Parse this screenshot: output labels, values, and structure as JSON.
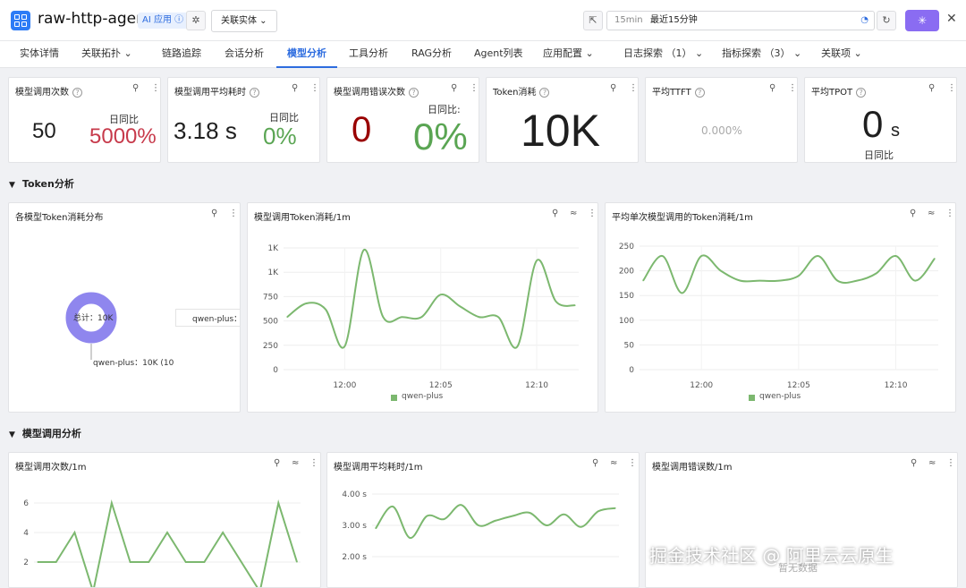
{
  "header": {
    "title": "raw-http-agent",
    "ai_badge": "AI 应用 ⓘ",
    "related_entity": "关联实体 ⌄",
    "time_prefix": "15min",
    "time_value": "最近15分钟"
  },
  "tabs": [
    {
      "label": "实体详情"
    },
    {
      "label": "关联拓扑 ⌄"
    },
    {
      "label": "链路追踪"
    },
    {
      "label": "会话分析"
    },
    {
      "label": "模型分析"
    },
    {
      "label": "工具分析"
    },
    {
      "label": "RAG分析"
    },
    {
      "label": "Agent列表"
    },
    {
      "label": "应用配置 ⌄"
    },
    {
      "label": "日志探索 （1） ⌄"
    },
    {
      "label": "指标探索 （3） ⌄"
    },
    {
      "label": "关联项 ⌄"
    }
  ],
  "kpis": {
    "calls": {
      "title": "模型调用次数",
      "value": "50",
      "compare_label": "日同比",
      "compare_value": "5000%"
    },
    "latency": {
      "title": "模型调用平均耗时",
      "value": "3.18 s",
      "compare_label": "日同比",
      "compare_value": "0%"
    },
    "errors": {
      "title": "模型调用错误次数",
      "value": "0",
      "compare_label": "日同比:",
      "compare_value": "0%"
    },
    "tokens": {
      "title": "Token消耗",
      "value": "10K"
    },
    "ttft": {
      "title": "平均TTFT",
      "value": "0.000%"
    },
    "tpot": {
      "title": "平均TPOT",
      "value": "0",
      "unit": "s",
      "compare_label": "日同比"
    }
  },
  "sections": {
    "token": "Token分析",
    "model_call": "模型调用分析"
  },
  "colors": {
    "series": "#7cb86f",
    "donut": "#8f86ee",
    "accent": "#2d6cdf"
  },
  "charts": {
    "token_distribution": {
      "title": "各模型Token消耗分布",
      "center_label": "总计：10K",
      "legend": "qwen-plus：",
      "slice_label": "qwen-plus：10K (10",
      "chart_data": {
        "type": "pie",
        "slices": [
          {
            "name": "qwen-plus",
            "value": 10000
          }
        ]
      }
    },
    "token_per_min": {
      "title": "模型调用Token消耗/1m",
      "legend": "qwen-plus",
      "chart_data": {
        "type": "line",
        "x": [
          "11:57",
          "11:58",
          "11:59",
          "12:00",
          "12:01",
          "12:02",
          "12:03",
          "12:04",
          "12:05",
          "12:06",
          "12:07",
          "12:08",
          "12:09",
          "12:10",
          "12:11",
          "12:12"
        ],
        "series": [
          {
            "name": "qwen-plus",
            "values": [
              540,
              680,
              620,
              240,
              1230,
              540,
              540,
              540,
              770,
              650,
              540,
              540,
              240,
              1120,
              700,
              660
            ]
          }
        ],
        "y_ticks": [
          "0",
          "250",
          "500",
          "750",
          "1K",
          "1K"
        ],
        "x_ticks": [
          "12:00",
          "12:05",
          "12:10"
        ],
        "ylim": [
          0,
          1250
        ]
      }
    },
    "avg_token_per_call": {
      "title": "平均单次模型调用的Token消耗/1m",
      "legend": "qwen-plus",
      "chart_data": {
        "type": "line",
        "x": [
          "11:57",
          "11:58",
          "11:59",
          "12:00",
          "12:01",
          "12:02",
          "12:03",
          "12:04",
          "12:05",
          "12:06",
          "12:07",
          "12:08",
          "12:09",
          "12:10",
          "12:11",
          "12:12"
        ],
        "series": [
          {
            "name": "qwen-plus",
            "values": [
              180,
              230,
              155,
              230,
              200,
              180,
              180,
              180,
              190,
              230,
              180,
              180,
              195,
              230,
              180,
              225
            ]
          }
        ],
        "y_ticks": [
          "0",
          "50",
          "100",
          "150",
          "200",
          "250"
        ],
        "x_ticks": [
          "12:00",
          "12:05",
          "12:10"
        ],
        "ylim": [
          0,
          250
        ]
      }
    },
    "calls_per_min": {
      "title": "模型调用次数/1m",
      "chart_data": {
        "type": "line",
        "x": [
          "11:57",
          "11:58",
          "11:59",
          "12:00",
          "12:01",
          "12:02",
          "12:03",
          "12:04",
          "12:05",
          "12:06",
          "12:07",
          "12:08",
          "12:09",
          "12:10",
          "12:11"
        ],
        "series": [
          {
            "name": "qwen-plus",
            "values": [
              2,
              2,
              4,
              0,
              6,
              2,
              2,
              4,
              2,
              2,
              4,
              2,
              0,
              6,
              2
            ]
          }
        ],
        "y_ticks": [
          "2",
          "4",
          "6"
        ],
        "ylim": [
          2,
          6
        ]
      }
    },
    "avg_latency_per_min": {
      "title": "模型调用平均耗时/1m",
      "chart_data": {
        "type": "line",
        "x": [
          "11:57",
          "11:58",
          "11:59",
          "12:00",
          "12:01",
          "12:02",
          "12:03",
          "12:04",
          "12:05",
          "12:06",
          "12:07",
          "12:08",
          "12:09",
          "12:10",
          "12:11"
        ],
        "series": [
          {
            "name": "qwen-plus",
            "values": [
              2.9,
              3.6,
              2.6,
              3.3,
              3.2,
              3.65,
              3.0,
              3.15,
              3.3,
              3.4,
              3.0,
              3.35,
              2.95,
              3.45,
              3.55
            ]
          }
        ],
        "y_ticks": [
          "2.00 s",
          "3.00 s",
          "4.00 s"
        ],
        "ylim": [
          2,
          4
        ]
      }
    },
    "errors_per_min": {
      "title": "模型调用错误数/1m",
      "empty_text": "暂无数据"
    }
  },
  "watermark": "掘金技术社区 @ 阿里云云原生"
}
